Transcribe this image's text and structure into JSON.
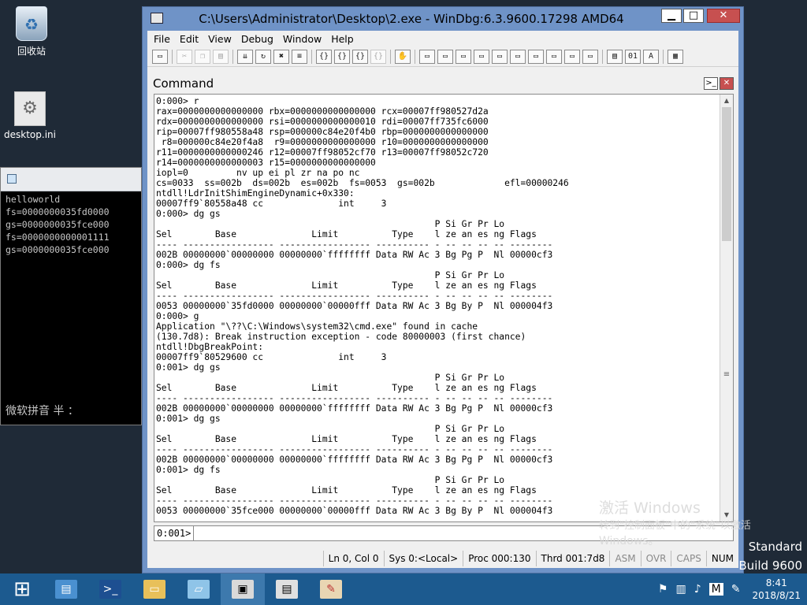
{
  "desktop": {
    "icons": [
      {
        "label": "回收站",
        "icon": "recycle-bin-icon"
      },
      {
        "label": "desktop.ini",
        "icon": "settings-file-icon"
      }
    ]
  },
  "console": {
    "lines": "helloworld\nfs=0000000035fd0000\ngs=0000000035fce000\nfs=0000000000001111\ngs=0000000035fce000",
    "ime": "微软拼音 半 ："
  },
  "windbg": {
    "title": "C:\\Users\\Administrator\\Desktop\\2.exe - WinDbg:6.3.9600.17298 AMD64",
    "menu": [
      "File",
      "Edit",
      "View",
      "Debug",
      "Window",
      "Help"
    ],
    "command_title": "Command",
    "output": "0:000> r\nrax=0000000000000000 rbx=0000000000000000 rcx=00007ff980527d2a\nrdx=0000000000000000 rsi=0000000000000010 rdi=00007ff735fc6000\nrip=00007ff980558a48 rsp=000000c84e20f4b0 rbp=0000000000000000\n r8=000000c84e20f4a8  r9=0000000000000000 r10=0000000000000000\nr11=0000000000000246 r12=00007ff98052cf70 r13=00007ff98052c720\nr14=0000000000000003 r15=0000000000000000\niopl=0         nv up ei pl zr na po nc\ncs=0033  ss=002b  ds=002b  es=002b  fs=0053  gs=002b             efl=00000246\nntdll!LdrInitShimEngineDynamic+0x330:\n00007ff9`80558a48 cc              int     3\n0:000> dg gs\n                                                    P Si Gr Pr Lo\nSel        Base              Limit          Type    l ze an es ng Flags\n---- ----------------- ----------------- ---------- - -- -- -- -- --------\n002B 00000000`00000000 00000000`ffffffff Data RW Ac 3 Bg Pg P  Nl 00000cf3\n0:000> dg fs\n                                                    P Si Gr Pr Lo\nSel        Base              Limit          Type    l ze an es ng Flags\n---- ----------------- ----------------- ---------- - -- -- -- -- --------\n0053 00000000`35fd0000 00000000`00000fff Data RW Ac 3 Bg By P  Nl 000004f3\n0:000> g\nApplication \"\\??\\C:\\Windows\\system32\\cmd.exe\" found in cache\n(130.7d8): Break instruction exception - code 80000003 (first chance)\nntdll!DbgBreakPoint:\n00007ff9`80529600 cc              int     3\n0:001> dg gs\n                                                    P Si Gr Pr Lo\nSel        Base              Limit          Type    l ze an es ng Flags\n---- ----------------- ----------------- ---------- - -- -- -- -- --------\n002B 00000000`00000000 00000000`ffffffff Data RW Ac 3 Bg Pg P  Nl 00000cf3\n0:001> dg gs\n                                                    P Si Gr Pr Lo\nSel        Base              Limit          Type    l ze an es ng Flags\n---- ----------------- ----------------- ---------- - -- -- -- -- --------\n002B 00000000`00000000 00000000`ffffffff Data RW Ac 3 Bg Pg P  Nl 00000cf3\n0:001> dg fs\n                                                    P Si Gr Pr Lo\nSel        Base              Limit          Type    l ze an es ng Flags\n---- ----------------- ----------------- ---------- - -- -- -- -- --------\n0053 00000000`35fce000 00000000`00000fff Data RW Ac 3 Bg By P  Nl 000004f3",
    "prompt": "0:001>",
    "input_value": "",
    "status": {
      "pos": "Ln 0, Col 0",
      "sys": "Sys 0:<Local>",
      "proc": "Proc 000:130",
      "thrd": "Thrd 001:7d8",
      "asm": "ASM",
      "ovr": "OVR",
      "caps": "CAPS",
      "num": "NUM"
    }
  },
  "watermark": {
    "line1": "激活 Windows",
    "line2": "转到\"控制面板\"中的\"系统\"以激活",
    "line3": "Windows。",
    "edition1": "Standard",
    "edition2": "Build 9600"
  },
  "taskbar": {
    "tray_lang": "M",
    "time": "8:41",
    "date": "2018/8/21"
  },
  "colors": {
    "taskbar": "#1c5a8f",
    "windbg_frame": "#6f93c7",
    "close_button": "#c75050"
  }
}
